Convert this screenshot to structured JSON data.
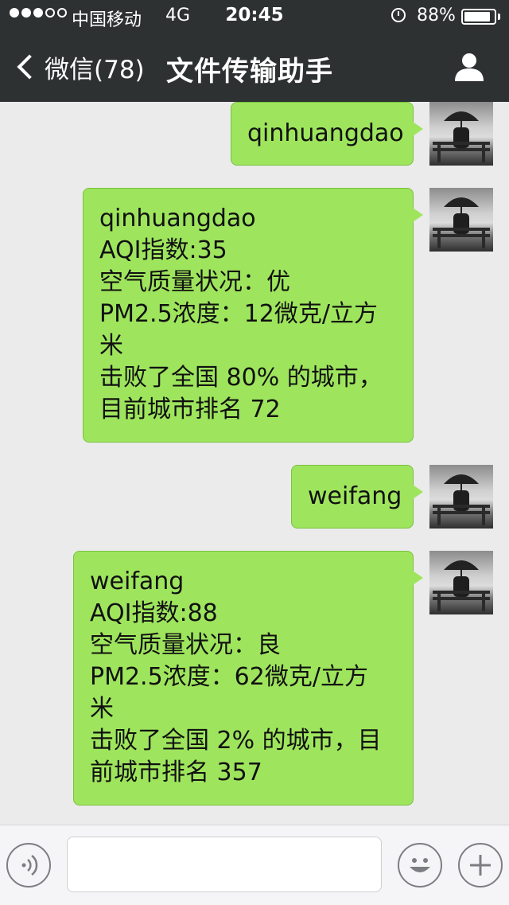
{
  "status_bar": {
    "carrier": "中国移动",
    "network": "4G",
    "time": "20:45",
    "battery": "88%",
    "battery_level": 0.88,
    "signal_bars_filled": 3,
    "signal_bars_total": 5
  },
  "nav": {
    "back_label": "微信(78)",
    "title": "文件传输助手",
    "profile_icon": "person-icon"
  },
  "messages": [
    {
      "from": "me",
      "text": "qinhuangdao"
    },
    {
      "from": "me",
      "text": "qinhuangdao\nAQI指数:35\n空气质量状况：优\nPM2.5浓度：12微克/立方\n米\n击败了全国 80% 的城市，\n目前城市排名 72"
    },
    {
      "from": "me",
      "text": "weifang"
    },
    {
      "from": "me",
      "text": "weifang\nAQI指数:88\n空气质量状况：良\nPM2.5浓度：62微克/立方\n米\n击败了全国 2% 的城市，目\n前城市排名 357"
    }
  ],
  "input_bar": {
    "voice_icon": "voice-icon",
    "emoji_icon": "emoji-icon",
    "plus_icon": "plus-icon",
    "text_value": ""
  },
  "colors": {
    "header_bg": "#2e3132",
    "bubble_bg": "#9ee55d",
    "chat_bg": "#ebebeb"
  }
}
